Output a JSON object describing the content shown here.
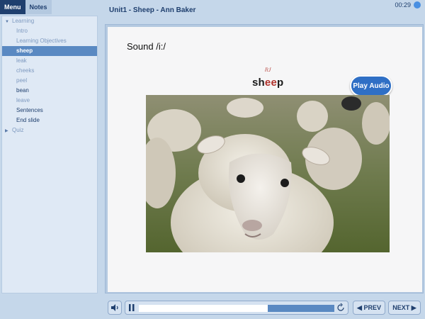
{
  "sidebar": {
    "tabs": [
      {
        "label": "Menu",
        "active": true
      },
      {
        "label": "Notes",
        "active": false
      }
    ],
    "sections": [
      {
        "label": "Learning",
        "expanded": true,
        "items": [
          {
            "label": "Intro",
            "state": "unvisited"
          },
          {
            "label": "Learning Objectives",
            "state": "unvisited"
          },
          {
            "label": "sheep",
            "state": "selected"
          },
          {
            "label": "leak",
            "state": "unvisited"
          },
          {
            "label": "cheeks",
            "state": "unvisited"
          },
          {
            "label": "peel",
            "state": "unvisited"
          },
          {
            "label": "bean",
            "state": "visited"
          },
          {
            "label": "leave",
            "state": "unvisited"
          },
          {
            "label": "Sentences",
            "state": "visited"
          },
          {
            "label": "End slide",
            "state": "visited"
          }
        ]
      },
      {
        "label": "Quiz",
        "expanded": false,
        "items": []
      }
    ]
  },
  "header": {
    "title": "Unit1 - Sheep - Ann Baker",
    "timer": "00:29"
  },
  "slide": {
    "sound_label": "Sound /i:/",
    "phonetic": "/i:/",
    "word_prefix": "sh",
    "word_highlight": "ee",
    "word_suffix": "p",
    "play_audio_label": "Play Audio"
  },
  "player": {
    "progress_fraction": 0.66,
    "prev_label": "PREV",
    "next_label": "NEXT"
  },
  "colors": {
    "accent": "#2f6fc5",
    "highlight": "#b0322c",
    "selected": "#5a89c2"
  }
}
